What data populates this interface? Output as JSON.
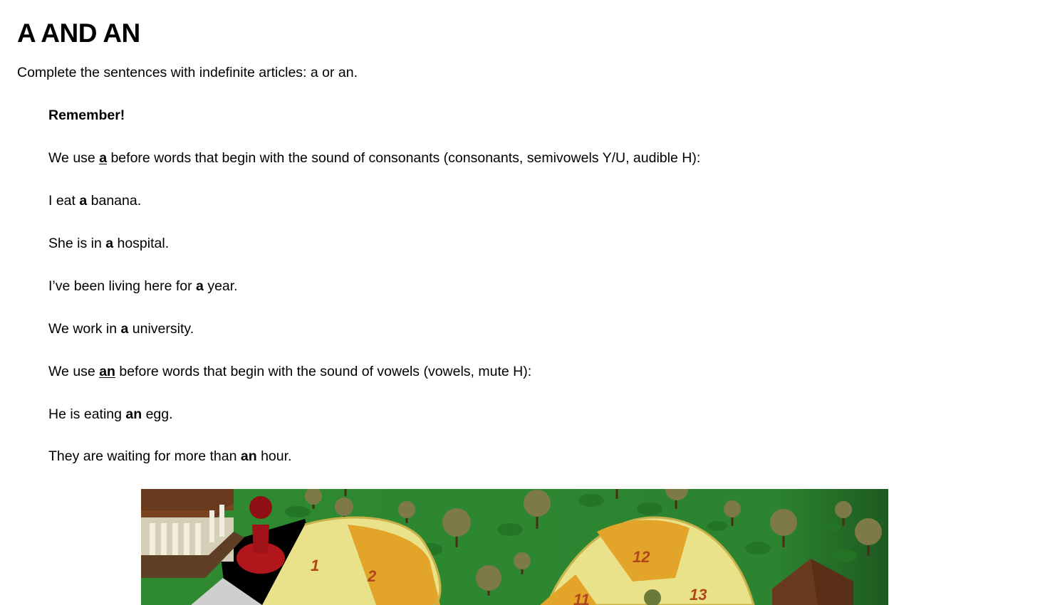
{
  "title": "A AND AN",
  "intro": "Complete the sentences with indefinite articles: a or an.",
  "remember": {
    "heading": "Remember!",
    "rule_a": {
      "pre": "We use ",
      "article": "a",
      "post": " before words that begin with the sound of consonants (consonants, semivowels Y/U, audible H):"
    },
    "examples_a": [
      {
        "pre": "I eat ",
        "article": "a",
        "post": " banana."
      },
      {
        "pre": "She is in ",
        "article": "a",
        "post": " hospital."
      },
      {
        "pre": "I’ve been living here for ",
        "article": "a",
        "post": " year."
      },
      {
        "pre": "We work in ",
        "article": "a",
        "post": " university."
      }
    ],
    "rule_an": {
      "pre": "We use ",
      "article": "an",
      "post": " before words that begin with the sound of vowels (vowels, mute H):"
    },
    "examples_an": [
      {
        "pre": "He is eating ",
        "article": "an",
        "post": " egg."
      },
      {
        "pre": "They are waiting for more than ",
        "article": "an",
        "post": " hour."
      }
    ]
  },
  "board_image": {
    "square_numbers": [
      "1",
      "2",
      "11",
      "12",
      "13"
    ],
    "colors": {
      "grass": "#2f8a2f",
      "track_light": "#e9e28a",
      "track_dark": "#e2a52a",
      "pawn": "#b0161b",
      "number": "#b0461b"
    }
  }
}
